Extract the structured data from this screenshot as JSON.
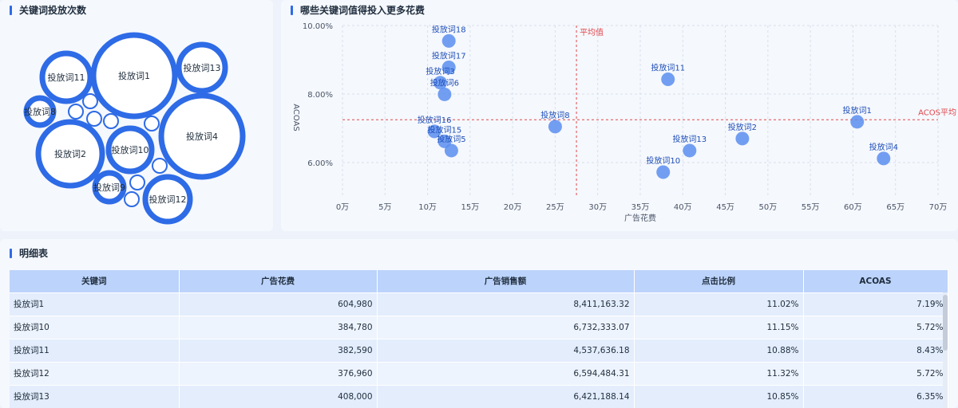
{
  "bubble_panel": {
    "title": "关键词投放次数",
    "bubbles": [
      {
        "label": "投放词1"
      },
      {
        "label": "投放词4"
      },
      {
        "label": "投放词2"
      },
      {
        "label": "投放词10"
      },
      {
        "label": "投放词11"
      },
      {
        "label": "投放词13"
      },
      {
        "label": "投放词12"
      },
      {
        "label": "投放词8"
      },
      {
        "label": "投放词9"
      }
    ]
  },
  "scatter_panel": {
    "title": "哪些关键词值得投入更多花费",
    "avg_x_label": "平均值",
    "avg_y_label": "ACOS平均"
  },
  "chart_data": {
    "type": "scatter",
    "xlabel": "广告花费",
    "ylabel": "ACOAS",
    "xlim": [
      0,
      700000
    ],
    "ylim": [
      5.0,
      10.0
    ],
    "x_ticks": [
      "0万",
      "5万",
      "10万",
      "15万",
      "20万",
      "25万",
      "30万",
      "35万",
      "40万",
      "45万",
      "50万",
      "55万",
      "60万",
      "65万",
      "70万"
    ],
    "y_ticks": [
      "6.00%",
      "8.00%",
      "10.00%"
    ],
    "avg_x": 275000,
    "avg_y": 7.25,
    "points": [
      {
        "name": "投放词18",
        "x": 125000,
        "y": 9.55
      },
      {
        "name": "投放词17",
        "x": 125000,
        "y": 8.78
      },
      {
        "name": "投放词3",
        "x": 115000,
        "y": 8.33
      },
      {
        "name": "投放词6",
        "x": 120000,
        "y": 7.99
      },
      {
        "name": "投放词16",
        "x": 108000,
        "y": 6.91
      },
      {
        "name": "投放词15",
        "x": 120000,
        "y": 6.62
      },
      {
        "name": "投放词5",
        "x": 128000,
        "y": 6.35
      },
      {
        "name": "投放词8",
        "x": 250000,
        "y": 7.05
      },
      {
        "name": "投放词11",
        "x": 382590,
        "y": 8.43
      },
      {
        "name": "投放词13",
        "x": 408000,
        "y": 6.35
      },
      {
        "name": "投放词10",
        "x": 376960,
        "y": 5.72
      },
      {
        "name": "投放词2",
        "x": 470000,
        "y": 6.7
      },
      {
        "name": "投放词1",
        "x": 604980,
        "y": 7.19
      },
      {
        "name": "投放词4",
        "x": 636000,
        "y": 6.12
      }
    ]
  },
  "table": {
    "title": "明细表",
    "headers": [
      "关键词",
      "广告花费",
      "广告销售额",
      "点击比例",
      "ACOAS"
    ],
    "rows": [
      [
        "投放词1",
        "604,980",
        "8,411,163.32",
        "11.02%",
        "7.19%"
      ],
      [
        "投放词10",
        "384,780",
        "6,732,333.07",
        "11.15%",
        "5.72%"
      ],
      [
        "投放词11",
        "382,590",
        "4,537,636.18",
        "10.88%",
        "8.43%"
      ],
      [
        "投放词12",
        "376,960",
        "6,594,484.31",
        "11.32%",
        "5.72%"
      ],
      [
        "投放词13",
        "408,000",
        "6,421,188.14",
        "10.85%",
        "6.35%"
      ]
    ]
  },
  "colors": {
    "accent": "#2e6be6",
    "point": "#5b8ef0",
    "label": "#1f4fb8",
    "avg_line": "#e0474c",
    "header_bg": "#bcd3fb"
  }
}
